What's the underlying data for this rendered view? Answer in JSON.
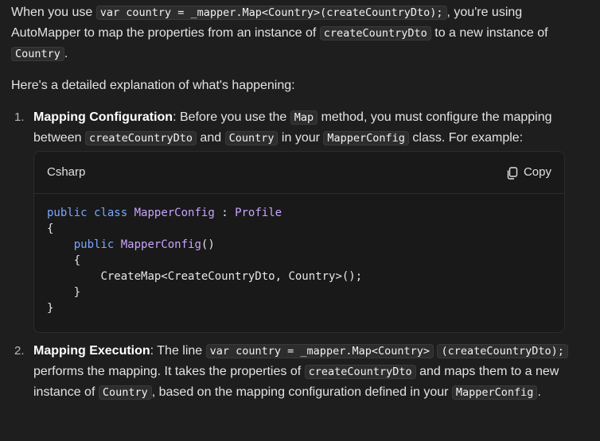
{
  "intro": {
    "t1": "When you use ",
    "code1": "var country = _mapper.Map<Country>(createCountryDto);",
    "t2": ", you're using AutoMapper to map the properties from an instance of ",
    "code2": "createCountryDto",
    "t3": " to a new instance of ",
    "code3": "Country",
    "t4": "."
  },
  "subheading": "Here's a detailed explanation of what's happening:",
  "step1": {
    "number": "1.",
    "title": "Mapping Configuration",
    "t1": ": Before you use the ",
    "code1": "Map",
    "t2": " method, you must configure the mapping between ",
    "code2": "createCountryDto",
    "t3": " and ",
    "code3": "Country",
    "t4": " in your ",
    "code4": "MapperConfig",
    "t5": " class. For example:"
  },
  "codeblock": {
    "language": "Csharp",
    "copy_label": "Copy",
    "lines": {
      "l1_kw1": "public",
      "l1_kw2": "class",
      "l1_name": "MapperConfig",
      "l1_colon": " : ",
      "l1_base": "Profile",
      "l2": "{",
      "l3_kw": "public",
      "l3_name": "MapperConfig",
      "l3_paren": "()",
      "l4": "{",
      "l5": "CreateMap<CreateCountryDto, Country>();",
      "l6": "}",
      "l7": "}"
    }
  },
  "step2": {
    "number": "2.",
    "title": "Mapping Execution",
    "t1": ": The line ",
    "code1": "var country = _mapper.Map<Country>",
    "code1b": "(createCountryDto);",
    "t2": " performs the mapping. It takes the properties of ",
    "code2": "createCountryDto",
    "t3": " and maps them to a new instance of ",
    "code3": "Country",
    "t4": ", based on the mapping configuration defined in your ",
    "code4": "MapperConfig",
    "t5": "."
  },
  "colors": {
    "background": "#1e1e1e",
    "keyword": "#7aa8ff",
    "type": "#c9a4ff"
  },
  "icons": {
    "copy": "copy-icon"
  }
}
